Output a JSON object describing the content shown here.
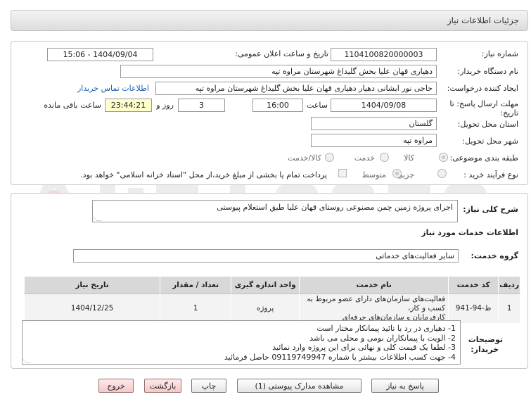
{
  "header": {
    "title": "جزئیات اطلاعات نیاز"
  },
  "form": {
    "need_number_label": "شماره نیاز:",
    "need_number": "1104100820000003",
    "announce_label": "تاریخ و ساعت اعلان عمومی:",
    "announce_value": "1404/09/04 - 15:06",
    "buyer_label": "نام دستگاه خریدار:",
    "buyer_value": "دهیاری قهان علیا بخش گلیداغ شهرستان مراوه تپه",
    "creator_label": "ایجاد کننده درخواست:",
    "creator_value": "حاجی نور ایشانی دهیار دهیاری قهان علیا بخش گلیداغ شهرستان مراوه تپه",
    "contact_link": "اطلاعات تماس خریدار",
    "deadline_label_1": "مهلت ارسال پاسخ: تا",
    "deadline_label_2": "تاریخ:",
    "deadline_date": "1404/09/08",
    "time_label": "ساعت",
    "deadline_time": "16:00",
    "days_value": "3",
    "days_label": "روز و",
    "remaining_time": "23:44:21",
    "remaining_label": "ساعت باقی مانده",
    "province_label": "استان محل تحویل:",
    "province_value": "گلستان",
    "city_label": "شهر محل تحویل:",
    "city_value": "مراوه تپه",
    "category_label": "طبقه بندی موضوعی:",
    "category_options": [
      "کالا",
      "خدمت",
      "کالا/خدمت"
    ],
    "process_label": "نوع فرآیند خرید :",
    "process_options": [
      "جزیی",
      "متوسط"
    ],
    "payment_note": "پرداخت تمام یا بخشی از مبلغ خرید،از محل \"اسناد خزانه اسلامی\" خواهد بود."
  },
  "description": {
    "label": "شرح کلی نیاز:",
    "value": "اجرای پروژه زمین چمن مصنوعی روستای قهان علیا طبق استعلام پیوستی"
  },
  "services": {
    "section_title": "اطلاعات خدمات مورد نیاز",
    "group_label": "گروه خدمت:",
    "group_value": "سایر فعالیت‌های خدماتی",
    "columns": [
      "ردیف",
      "کد خدمت",
      "نام خدمت",
      "واحد اندازه گیری",
      "تعداد / مقدار",
      "تاریخ نیاز"
    ],
    "rows": [
      {
        "index": "1",
        "code": "ط-94-941",
        "name_line1": "فعالیت‌های سازمان‌های دارای عضو مربوط به کسب و کار،",
        "name_line2": "کارفرمایان و سازمان‌های حرفه‌ای",
        "unit": "پروژه",
        "qty": "1",
        "date": "1404/12/25"
      }
    ]
  },
  "notes": {
    "label_1": "توضیحات",
    "label_2": "خریدار:",
    "lines": [
      "1- دهیاری در رد یا تائید پیمانکار مختار است",
      "2- الویت با پیمانکاران بومی و محلی می باشد",
      "3- لطفا یک قیمت کلی و نهائی برای این پروژه وارد نمائید",
      "4- جهت کسب اطلاعات بیشتر با شماره 09119749947 حاصل فرمائید"
    ]
  },
  "buttons": {
    "reply": "پاسخ به نیاز",
    "view_docs": "مشاهده مدارک پیوستی (1)",
    "print": "چاپ",
    "back": "بازگشت",
    "exit": "خروج"
  },
  "colors": {
    "link": "#1a5fb4",
    "exit_button": "#f3c9c9",
    "remaining_bg": "#ffffcc"
  }
}
